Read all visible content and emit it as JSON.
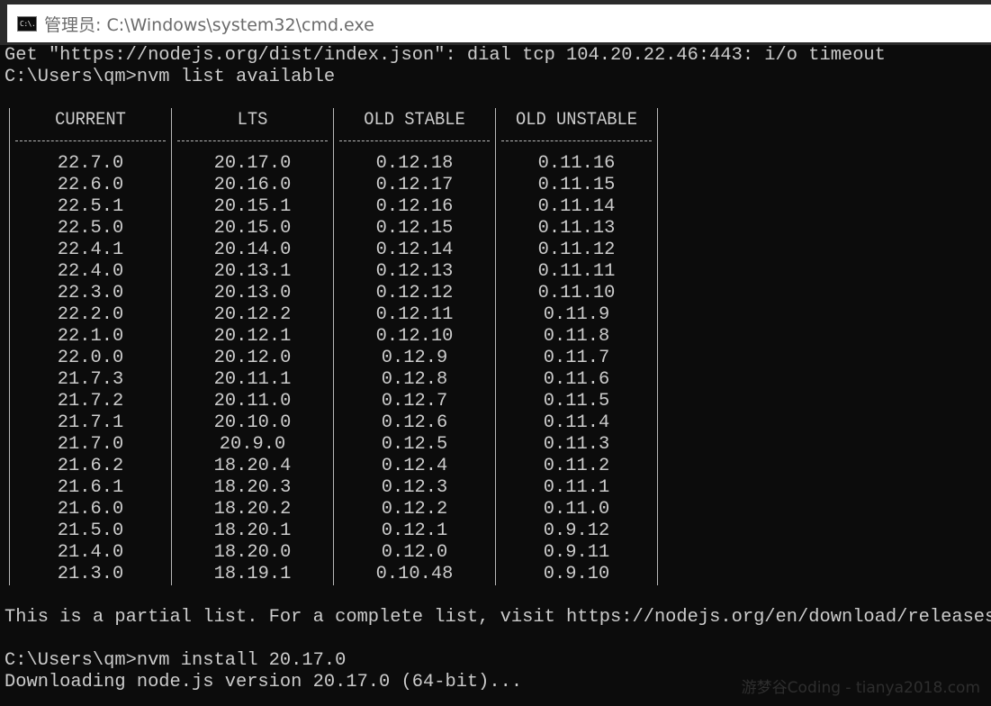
{
  "window": {
    "title": "管理员: C:\\Windows\\system32\\cmd.exe",
    "icon": "cmd-icon",
    "icon_text": "C:\\."
  },
  "console": {
    "lines_top": [
      "Get \"https://nodejs.org/dist/index.json\": dial tcp 104.20.22.46:443: i/o timeout",
      "C:\\Users\\qm>nvm list available"
    ],
    "table": {
      "headers": [
        "CURRENT",
        "LTS",
        "OLD STABLE",
        "OLD UNSTABLE"
      ],
      "rows": [
        [
          "22.7.0",
          "20.17.0",
          "0.12.18",
          "0.11.16"
        ],
        [
          "22.6.0",
          "20.16.0",
          "0.12.17",
          "0.11.15"
        ],
        [
          "22.5.1",
          "20.15.1",
          "0.12.16",
          "0.11.14"
        ],
        [
          "22.5.0",
          "20.15.0",
          "0.12.15",
          "0.11.13"
        ],
        [
          "22.4.1",
          "20.14.0",
          "0.12.14",
          "0.11.12"
        ],
        [
          "22.4.0",
          "20.13.1",
          "0.12.13",
          "0.11.11"
        ],
        [
          "22.3.0",
          "20.13.0",
          "0.12.12",
          "0.11.10"
        ],
        [
          "22.2.0",
          "20.12.2",
          "0.12.11",
          "0.11.9"
        ],
        [
          "22.1.0",
          "20.12.1",
          "0.12.10",
          "0.11.8"
        ],
        [
          "22.0.0",
          "20.12.0",
          "0.12.9",
          "0.11.7"
        ],
        [
          "21.7.3",
          "20.11.1",
          "0.12.8",
          "0.11.6"
        ],
        [
          "21.7.2",
          "20.11.0",
          "0.12.7",
          "0.11.5"
        ],
        [
          "21.7.1",
          "20.10.0",
          "0.12.6",
          "0.11.4"
        ],
        [
          "21.7.0",
          "20.9.0",
          "0.12.5",
          "0.11.3"
        ],
        [
          "21.6.2",
          "18.20.4",
          "0.12.4",
          "0.11.2"
        ],
        [
          "21.6.1",
          "18.20.3",
          "0.12.3",
          "0.11.1"
        ],
        [
          "21.6.0",
          "18.20.2",
          "0.12.2",
          "0.11.0"
        ],
        [
          "21.5.0",
          "18.20.1",
          "0.12.1",
          "0.9.12"
        ],
        [
          "21.4.0",
          "18.20.0",
          "0.12.0",
          "0.9.11"
        ],
        [
          "21.3.0",
          "18.19.1",
          "0.10.48",
          "0.9.10"
        ]
      ]
    },
    "partial_note": "This is a partial list. For a complete list, visit https://nodejs.org/en/download/releases",
    "prompt_install": "C:\\Users\\qm>nvm install 20.17.0",
    "downloading": "Downloading node.js version 20.17.0 (64-bit)...",
    "watermark": "游梦谷Coding - tianya2018.com",
    "colors": {
      "background": "#0c0c0c",
      "text": "#cccccc",
      "titlebar": "#ffffff"
    }
  }
}
